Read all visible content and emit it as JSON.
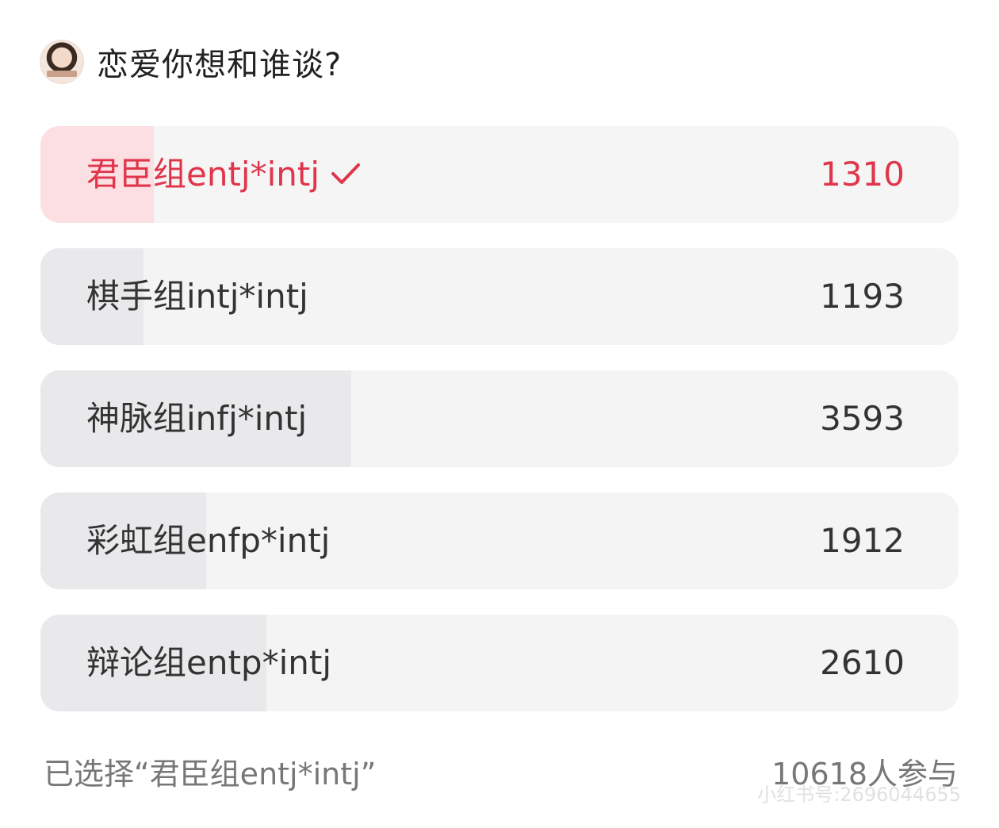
{
  "poll": {
    "question": "恋爱你想和谁谈?",
    "options": [
      {
        "label": "君臣组entj*intj",
        "count": "1310",
        "selected": true,
        "share": 0.1234
      },
      {
        "label": "棋手组intj*intj",
        "count": "1193",
        "selected": false,
        "share": 0.1124
      },
      {
        "label": "神脉组infj*intj",
        "count": "3593",
        "selected": false,
        "share": 0.3384
      },
      {
        "label": "彩虹组enfp*intj",
        "count": "1912",
        "selected": false,
        "share": 0.1801
      },
      {
        "label": "辩论组entp*intj",
        "count": "2610",
        "selected": false,
        "share": 0.2458
      }
    ],
    "selected_text": "已选择“君臣组entj*intj”",
    "participants": "10618人参与"
  },
  "watermark": "小红书号:2696044655",
  "colors": {
    "accent": "#e0354a",
    "selected_fill": "#fbdfe2",
    "bar_fill": "#e9e9eb",
    "option_bg": "#f4f4f4"
  },
  "icons": {
    "selected": "check-icon",
    "avatar": "avatar"
  }
}
